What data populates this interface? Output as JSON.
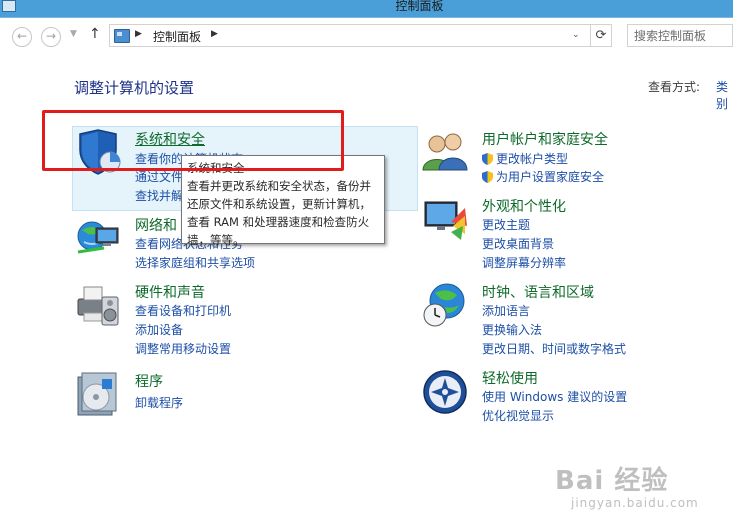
{
  "window": {
    "title": "控制面板"
  },
  "navbar": {
    "breadcrumb": "控制面板",
    "search_placeholder": "搜索控制面板",
    "back_glyph": "←",
    "forward_glyph": "→",
    "recent_glyph": "▼",
    "up_glyph": "↑",
    "refresh_glyph": "⟳",
    "sep_glyph": "▶",
    "drop_glyph": "⌄"
  },
  "main": {
    "heading": "调整计算机的设置",
    "view_by_label": "查看方式:",
    "view_by_value": "类别"
  },
  "categories": [
    {
      "title": "系统和安全",
      "links": [
        "查看你的计算机状态",
        "通过文件历史记录保存你的文件备份副本",
        "查找并解决问题"
      ],
      "icon": "shield-pie-icon"
    },
    {
      "title": "网络和 Internet",
      "links": [
        "查看网络状态和任务",
        "选择家庭组和共享选项"
      ],
      "icon": "network-globe-icon"
    },
    {
      "title": "硬件和声音",
      "links": [
        "查看设备和打印机",
        "添加设备",
        "调整常用移动设置"
      ],
      "icon": "printer-speaker-icon"
    },
    {
      "title": "程序",
      "links": [
        "卸载程序"
      ],
      "icon": "programs-disc-icon"
    },
    {
      "title": "用户帐户和家庭安全",
      "links": [
        "更改帐户类型",
        "为用户设置家庭安全"
      ],
      "icon": "users-icon"
    },
    {
      "title": "外观和个性化",
      "links": [
        "更改主题",
        "更改桌面背景",
        "调整屏幕分辨率"
      ],
      "icon": "monitor-palette-icon"
    },
    {
      "title": "时钟、语言和区域",
      "links": [
        "添加语言",
        "更换输入法",
        "更改日期、时间或数字格式"
      ],
      "icon": "globe-clock-icon"
    },
    {
      "title": "轻松使用",
      "links": [
        "使用 Windows 建议的设置",
        "优化视觉显示"
      ],
      "icon": "ease-of-access-icon"
    }
  ],
  "tooltip": {
    "title": "系统和安全",
    "description": "查看并更改系统和安全状态，备份并还原文件和系统设置，更新计算机，查看 RAM 和处理器速度和检查防火墙，等等。"
  },
  "watermark": {
    "logo": "Bai 经验",
    "url": "jingyan.baidu.com"
  },
  "colors": {
    "link": "#1d4fa6",
    "category_title": "#0e6a2a",
    "highlight": "#e21c1c",
    "hover": "#e5f3fb"
  }
}
